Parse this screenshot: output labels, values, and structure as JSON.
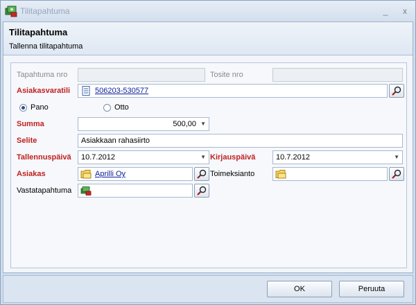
{
  "window": {
    "title": "Tilitapahtuma",
    "minimize": "_",
    "close": "x"
  },
  "header": {
    "title": "Tilitapahtuma",
    "subtitle": "Tallenna tilitapahtuma"
  },
  "form": {
    "tapahtuma_nro": {
      "label": "Tapahtuma nro",
      "value": ""
    },
    "tosite_nro": {
      "label": "Tosite nro",
      "value": ""
    },
    "asiakasvaratili": {
      "label": "Asiakasvaratili",
      "value": "506203-530577",
      "icon": "document-list-icon"
    },
    "direction": {
      "options": [
        "Pano",
        "Otto"
      ],
      "selected": "Pano"
    },
    "summa": {
      "label": "Summa",
      "value": "500,00"
    },
    "selite": {
      "label": "Selite",
      "value": "Asiakkaan rahasiirto"
    },
    "tallennuspaiva": {
      "label": "Tallennuspäivä",
      "value": "10.7.2012"
    },
    "kirjauspaiva": {
      "label": "Kirjauspäivä",
      "value": "10.7.2012"
    },
    "asiakas": {
      "label": "Asiakas",
      "value": "Aprilli Oy",
      "icon": "folder-icon"
    },
    "toimeksianto": {
      "label": "Toimeksianto",
      "value": "",
      "icon": "folder-icon"
    },
    "vastatapahtuma": {
      "label": "Vastatapahtuma",
      "value": "",
      "icon": "money-icon"
    }
  },
  "buttons": {
    "ok": "OK",
    "cancel": "Peruuta"
  },
  "colors": {
    "required_label": "#c02020",
    "link": "#0a1f9a",
    "frame": "#cfdcec"
  }
}
